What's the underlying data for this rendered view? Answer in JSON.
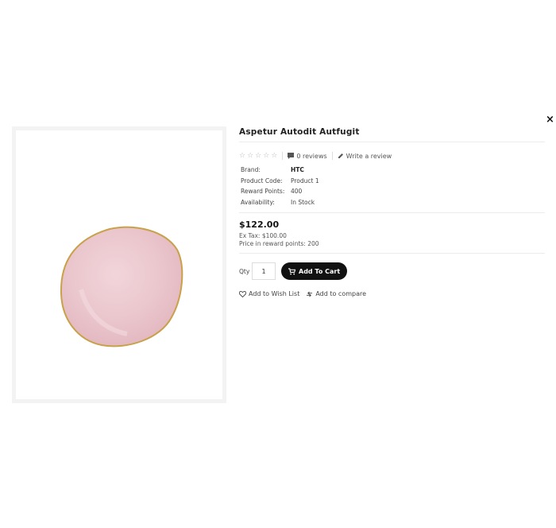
{
  "dialog": {
    "close_label": "×"
  },
  "product": {
    "title": "Aspetur Autodit Autfugit",
    "image_alt": "Pink plate with gold rim",
    "rating_stars": 0,
    "reviews_label": "0 reviews",
    "write_review_label": "Write a review",
    "specs": [
      {
        "key": "Brand:",
        "value": "HTC"
      },
      {
        "key": "Product Code:",
        "value": "Product 1"
      },
      {
        "key": "Reward Points:",
        "value": "400"
      },
      {
        "key": "Availability:",
        "value": "In Stock"
      }
    ],
    "price": "$122.00",
    "ex_tax": "Ex Tax: $100.00",
    "reward_price": "Price in reward points: 200"
  },
  "cart": {
    "qty_label": "Qty",
    "qty_value": "1",
    "add_to_cart_label": "Add To Cart"
  },
  "actions": {
    "wishlist_label": "Add to Wish List",
    "compare_label": "Add to compare"
  },
  "colors": {
    "plate_fill": "#ebc8ce",
    "plate_rim": "#c9a14a",
    "button_bg": "#111111"
  }
}
